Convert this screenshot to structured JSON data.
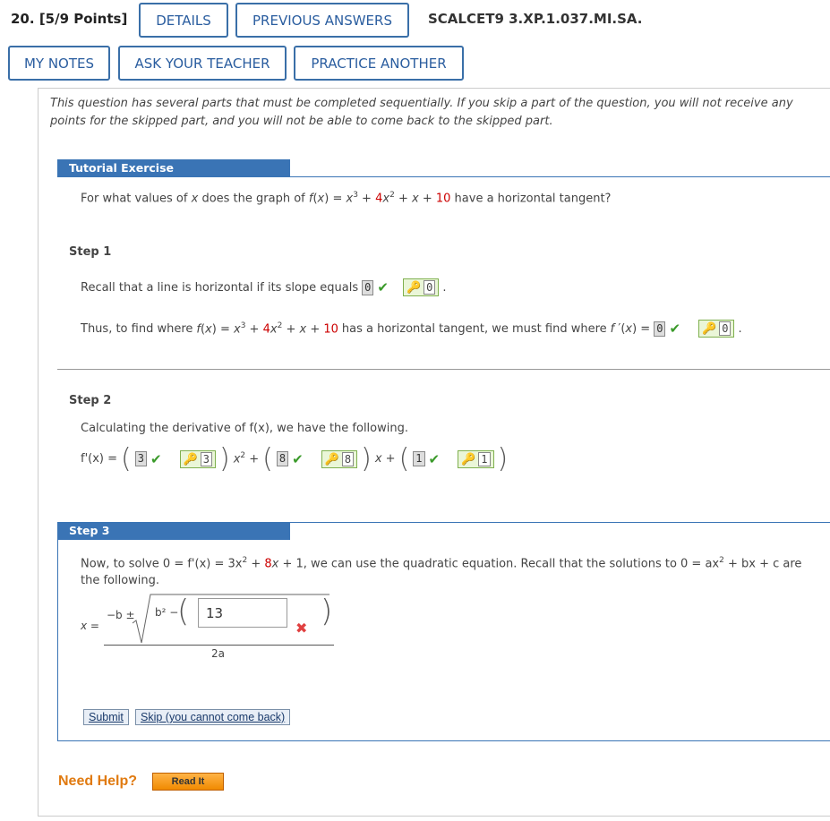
{
  "header": {
    "question_number": "20.",
    "points": "[5/9 Points]",
    "details_button": "DETAILS",
    "previous_answers_button": "PREVIOUS ANSWERS",
    "problem_code": "SCALCET9 3.XP.1.037.MI.SA.",
    "my_notes_button": "MY NOTES",
    "ask_teacher_button": "ASK YOUR TEACHER",
    "practice_another_button": "PRACTICE ANOTHER"
  },
  "intro_text": "This question has several parts that must be completed sequentially. If you skip a part of the question, you will not receive any points for the skipped part, and you will not be able to come back to the skipped part.",
  "tutorial": {
    "title": "Tutorial Exercise",
    "question": {
      "prefix": "For what values of",
      "var": "x",
      "middle": "does the graph of",
      "fx": "f(x)",
      "eq": "=",
      "suffix": "have a horizontal tangent?"
    }
  },
  "step1": {
    "label": "Step 1",
    "line1_text": "Recall that a line is horizontal if its slope equals",
    "line1_answer": "0",
    "line1_key": "0",
    "line2_prefix": "Thus, to find where",
    "line2_middle": "has a horizontal tangent, we must find where",
    "line2_answer": "0",
    "line2_key": "0"
  },
  "step2": {
    "label": "Step 2",
    "text": "Calculating the derivative of f(x), we have the following.",
    "deriv_label": "f'(x) =",
    "answers": [
      "3",
      "8",
      "1"
    ],
    "keys": [
      "3",
      "8",
      "1"
    ]
  },
  "step3": {
    "label": "Step 3",
    "text1": "Now, to solve 0 = f'(x) = 3x",
    "text2": ", we can use the quadratic equation. Recall that the solutions to 0 = ax",
    "text3": "+ bx + c are",
    "text4": "the following.",
    "x_eq": "x =",
    "numerator_prefix": "−b ±",
    "sqrt_prefix": "b² −",
    "input_value": "13",
    "denominator": "2a",
    "submit_button": "Submit",
    "skip_button": "Skip (you cannot come back)"
  },
  "help": {
    "label": "Need Help?",
    "read_it_button": "Read It"
  },
  "colors": {
    "accent": "#3a74b5",
    "button_border": "#3a6fa8",
    "correct": "#3a9a2a",
    "incorrect": "#e04040",
    "help": "#e07a10"
  }
}
